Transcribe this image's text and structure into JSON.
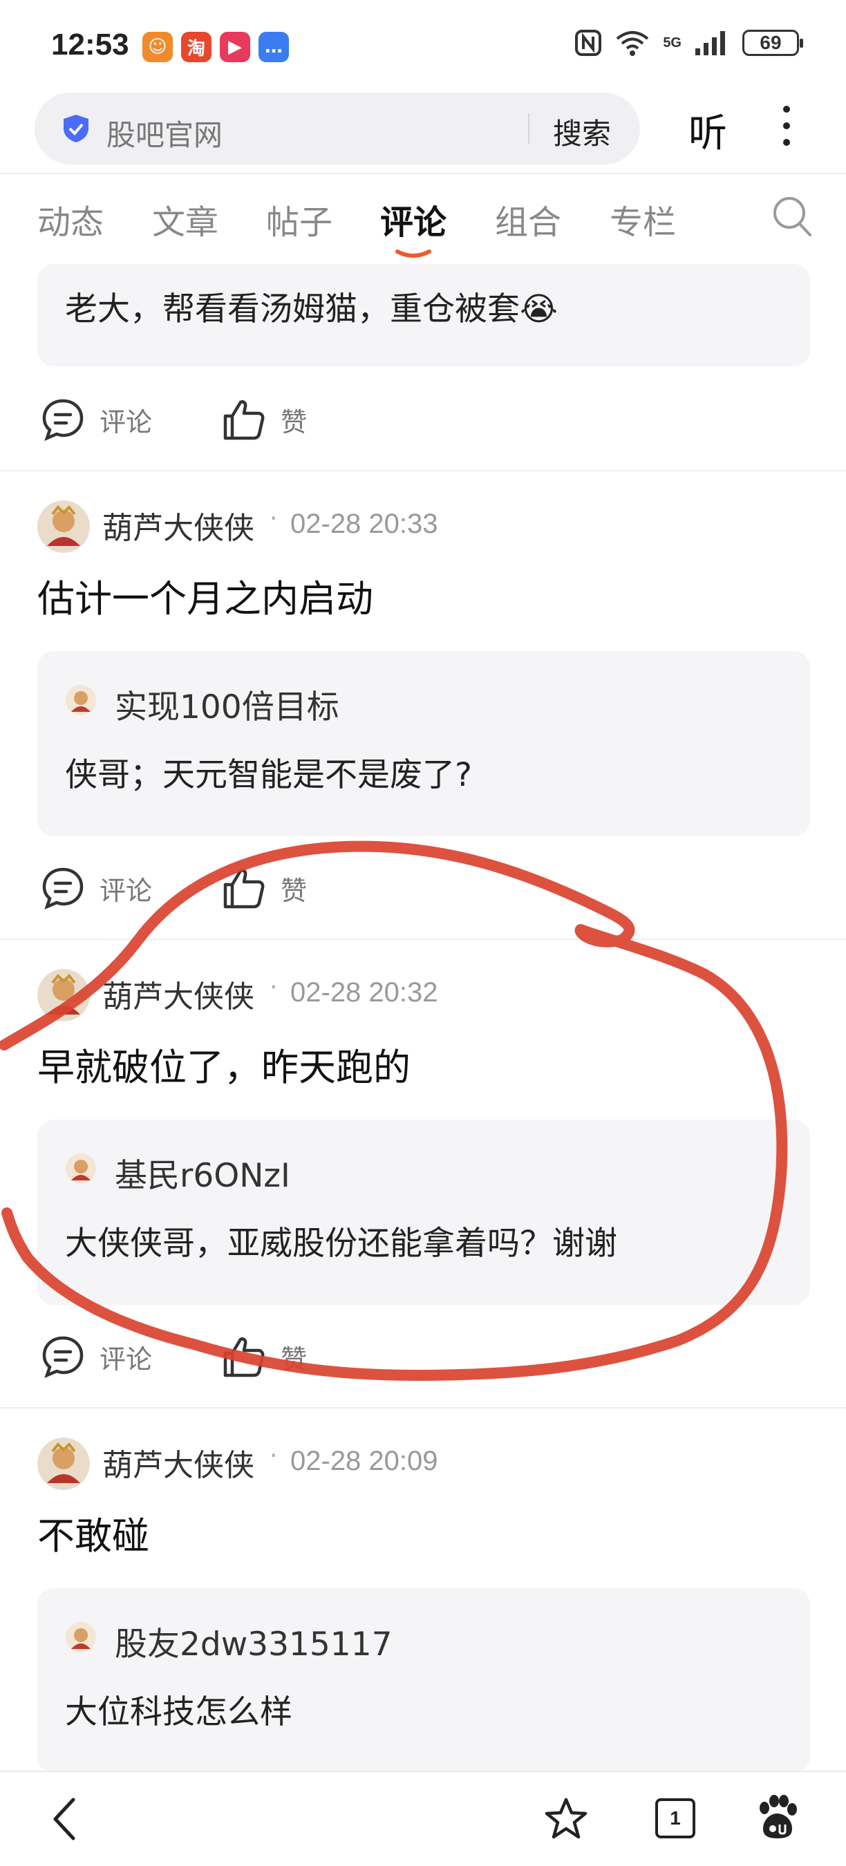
{
  "status_bar": {
    "time": "12:53",
    "app_icons": [
      {
        "name": "shop-app-icon",
        "glyph": "☺",
        "color": "#f08a2a"
      },
      {
        "name": "taobao-app-icon",
        "glyph": "淘",
        "color": "#e8472c"
      },
      {
        "name": "video-app-icon",
        "glyph": "▶",
        "color": "#e83a5c"
      },
      {
        "name": "message-app-icon",
        "glyph": "…",
        "color": "#3b7df0"
      }
    ],
    "nfc_label": "N",
    "network_label": "5G",
    "wifi_label": "6",
    "battery": "69"
  },
  "address_bar": {
    "site_name": "股吧官网",
    "search_label": "搜索",
    "listen_label": "听"
  },
  "tabs": [
    {
      "label": "动态",
      "active": false
    },
    {
      "label": "文章",
      "active": false
    },
    {
      "label": "帖子",
      "active": false
    },
    {
      "label": "评论",
      "active": true
    },
    {
      "label": "组合",
      "active": false
    },
    {
      "label": "专栏",
      "active": false
    }
  ],
  "actions": {
    "comment": "评论",
    "like": "赞"
  },
  "partial_post": {
    "quote_text": "老大，帮看看汤姆猫，重仓被套😭"
  },
  "posts": [
    {
      "author": "葫芦大侠侠",
      "time": "02-28 20:33",
      "text": "估计一个月之内启动",
      "quote_user": "实现100倍目标",
      "quote_text": "侠哥；天元智能是不是废了?"
    },
    {
      "author": "葫芦大侠侠",
      "time": "02-28 20:32",
      "text": "早就破位了，昨天跑的",
      "quote_user": "基民r6ONzI",
      "quote_text": "大侠侠哥，亚威股份还能拿着吗？谢谢"
    },
    {
      "author": "葫芦大侠侠",
      "time": "02-28 20:09",
      "text": "不敢碰",
      "quote_user": "股友2dw3315117",
      "quote_text": "大位科技怎么样"
    }
  ],
  "bottom_bar": {
    "tab_count": "1"
  },
  "colors": {
    "accent_orange": "#f05a2a",
    "shield_blue": "#4a6cf7",
    "scribble_red": "#d9432f"
  }
}
